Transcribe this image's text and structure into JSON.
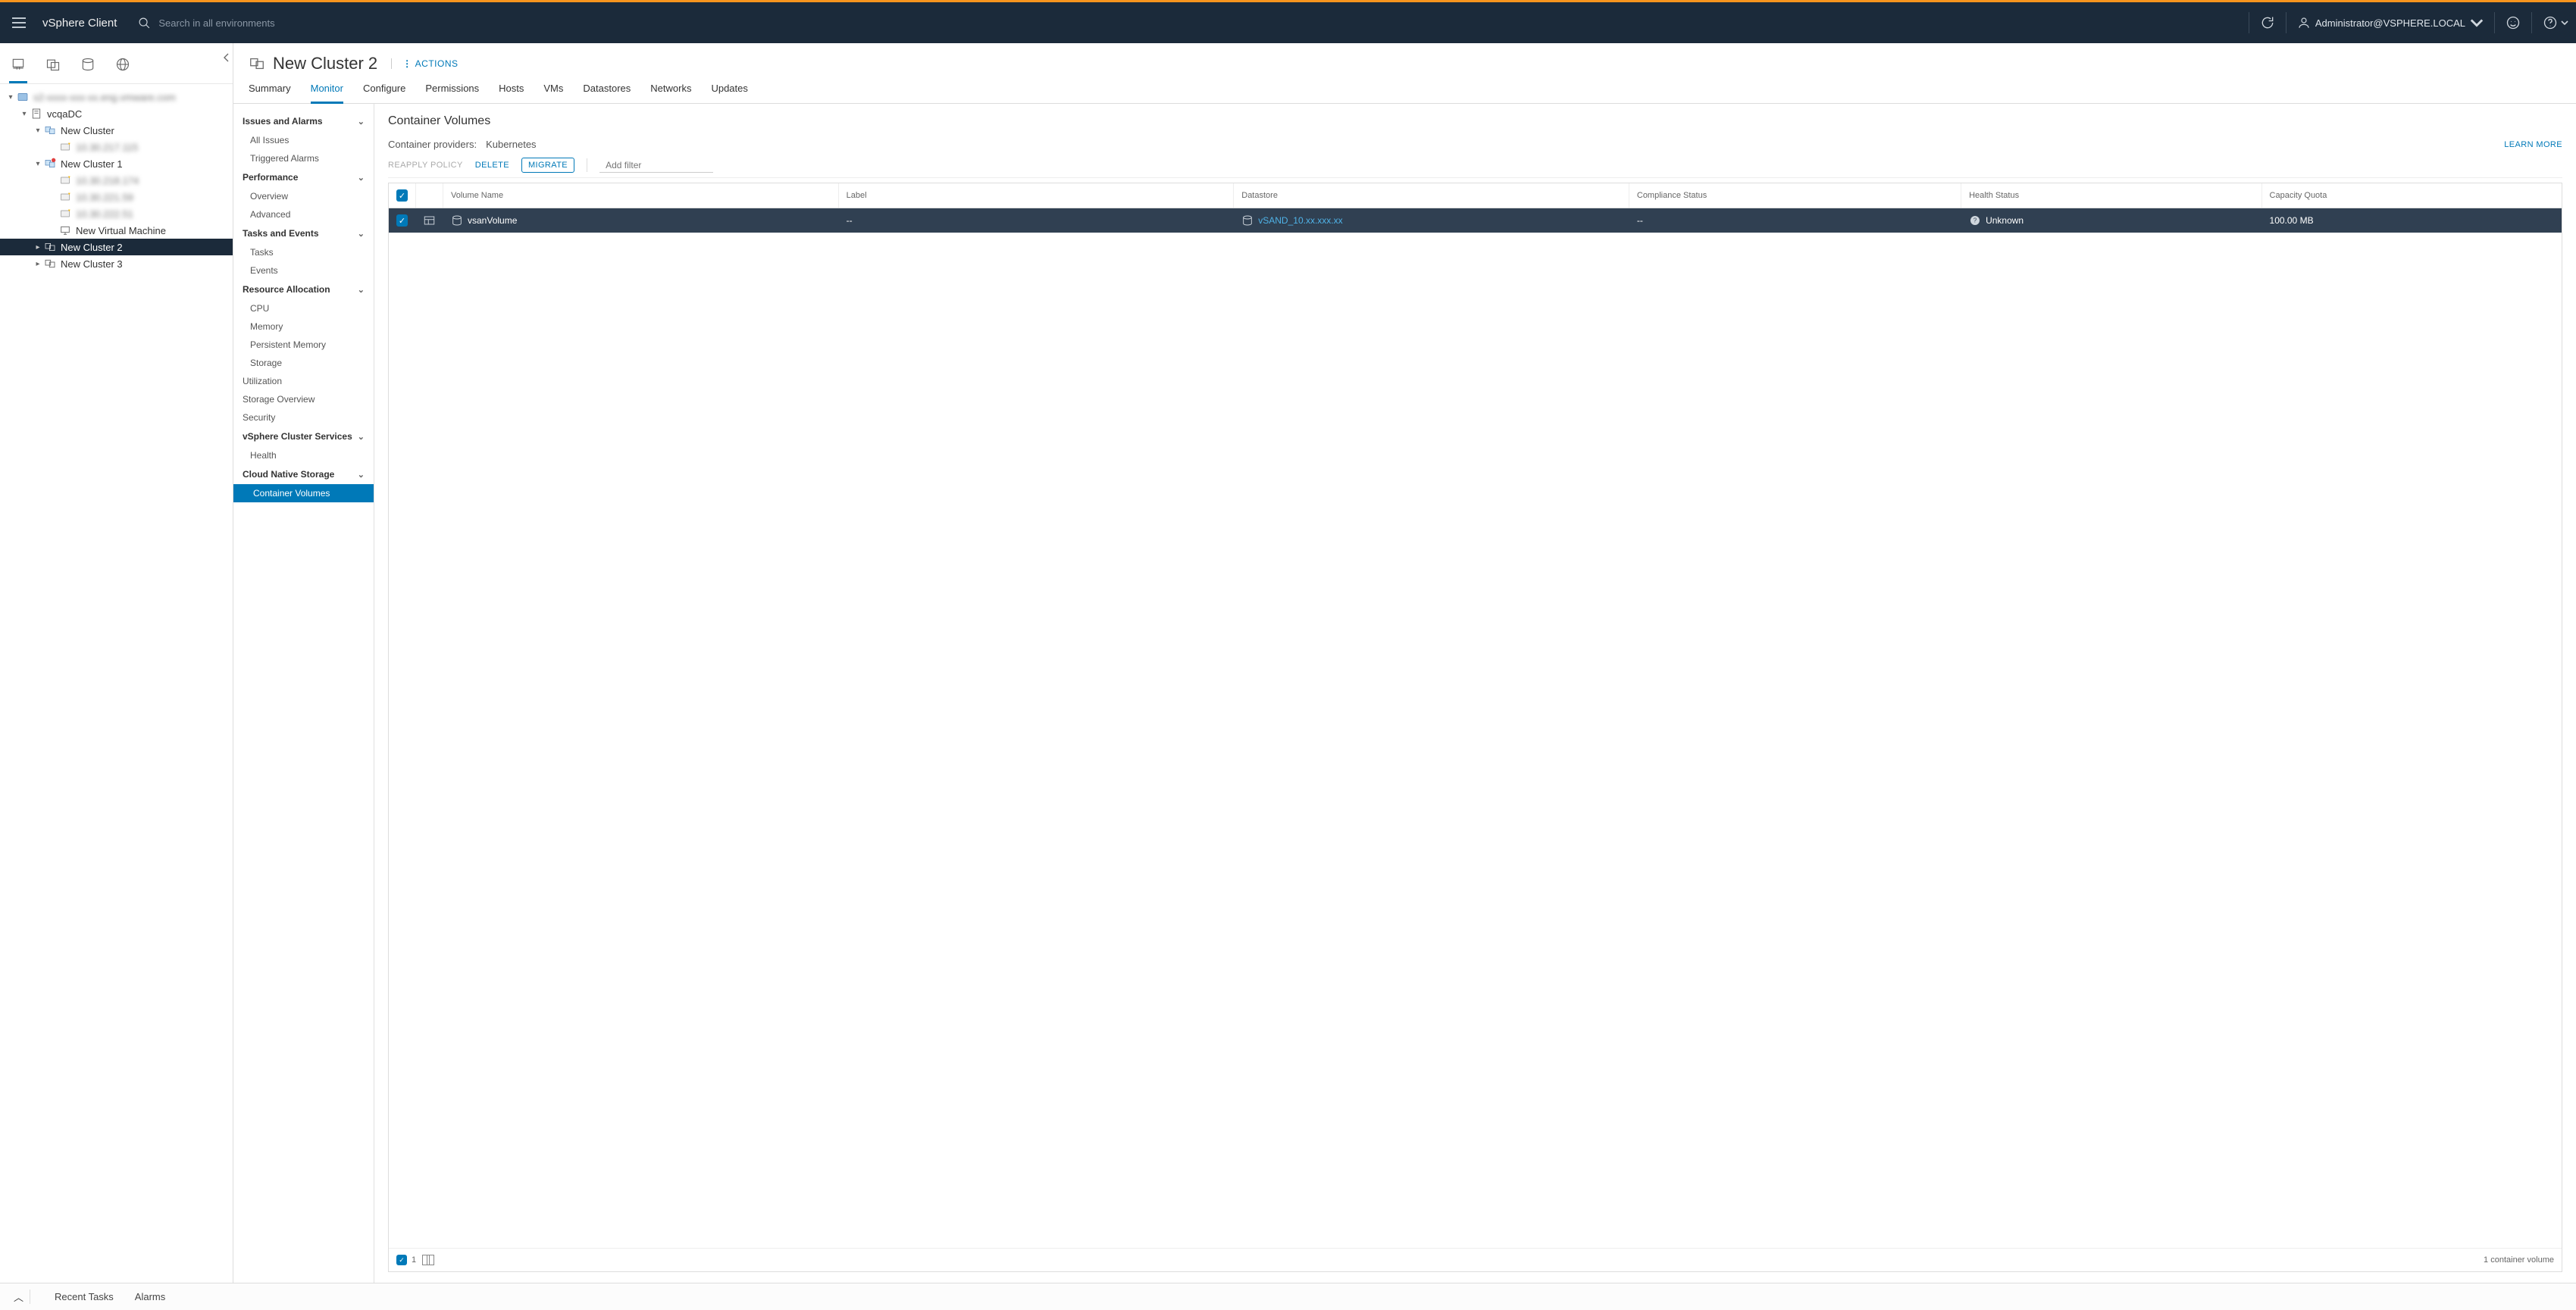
{
  "header": {
    "app_title": "vSphere Client",
    "search_placeholder": "Search in all environments",
    "user_label": "Administrator@VSPHERE.LOCAL"
  },
  "nav_tree": {
    "root_label": "s2-xxxx-xxx-xx.eng.vmware.com",
    "dc_label": "vcqaDC",
    "cluster0": "New Cluster",
    "cluster0_host0": "10.30.217.115",
    "cluster1": "New Cluster 1",
    "cluster1_host0": "10.30.218.174",
    "cluster1_host1": "10.30.221.59",
    "cluster1_host2": "10.30.222.51",
    "cluster1_vm0": "New Virtual Machine",
    "cluster2": "New Cluster 2",
    "cluster3": "New Cluster 3"
  },
  "page": {
    "title": "New Cluster 2",
    "actions_label": "ACTIONS",
    "tabs": [
      "Summary",
      "Monitor",
      "Configure",
      "Permissions",
      "Hosts",
      "VMs",
      "Datastores",
      "Networks",
      "Updates"
    ]
  },
  "side_menu": {
    "groups": {
      "issues": "Issues and Alarms",
      "perf": "Performance",
      "tasks": "Tasks and Events",
      "res": "Resource Allocation",
      "vcs": "vSphere Cluster Services",
      "cns": "Cloud Native Storage"
    },
    "items": {
      "all_issues": "All Issues",
      "triggered": "Triggered Alarms",
      "overview": "Overview",
      "advanced": "Advanced",
      "tasks": "Tasks",
      "events": "Events",
      "cpu": "CPU",
      "memory": "Memory",
      "pmem": "Persistent Memory",
      "storage": "Storage",
      "utilization": "Utilization",
      "storage_overview": "Storage Overview",
      "security": "Security",
      "health": "Health",
      "container_volumes": "Container Volumes"
    }
  },
  "detail": {
    "heading": "Container Volumes",
    "providers_label": "Container providers:",
    "providers_value": "Kubernetes",
    "learn_more": "LEARN MORE",
    "toolbar": {
      "reapply": "REAPPLY POLICY",
      "delete": "DELETE",
      "migrate": "MIGRATE",
      "filter_placeholder": "Add filter"
    },
    "columns": {
      "name": "Volume Name",
      "label": "Label",
      "datastore": "Datastore",
      "compliance": "Compliance Status",
      "health": "Health Status",
      "capacity": "Capacity Quota"
    },
    "row": {
      "name": "vsanVolume",
      "label": "--",
      "datastore": "vSAND_10.xx.xxx.xx",
      "compliance": "--",
      "health": "Unknown",
      "capacity": "100.00 MB"
    },
    "footer_count": "1",
    "footer_summary": "1 container volume"
  },
  "bottom": {
    "recent_tasks": "Recent Tasks",
    "alarms": "Alarms"
  }
}
